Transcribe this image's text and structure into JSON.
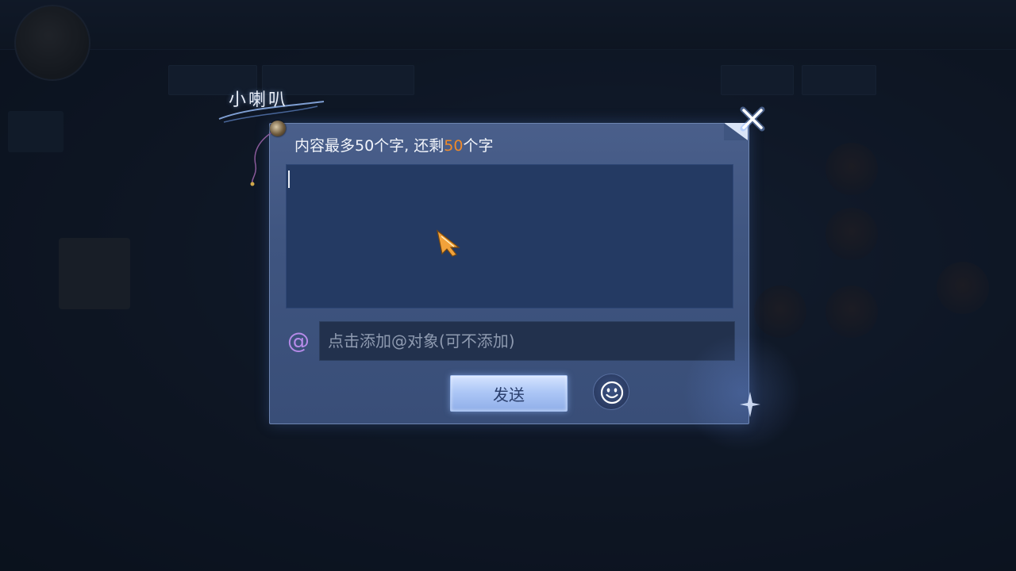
{
  "title": "小喇叭",
  "hint": {
    "prefix": "内容最多50个字, 还剩",
    "remaining": "50",
    "suffix": "个字"
  },
  "message": {
    "value": ""
  },
  "mention": {
    "at_symbol": "@",
    "placeholder": "点击添加@对象(可不添加)",
    "value": ""
  },
  "actions": {
    "send_label": "发送"
  },
  "icons": {
    "close": "close-icon",
    "emoji": "smiley-icon",
    "cursor": "arrow-cursor-icon"
  },
  "colors": {
    "remaining_count": "#f08a2a",
    "dialog_background": "#3f5580",
    "send_button": "#adc7f6",
    "at_symbol": "#b58ae8"
  }
}
